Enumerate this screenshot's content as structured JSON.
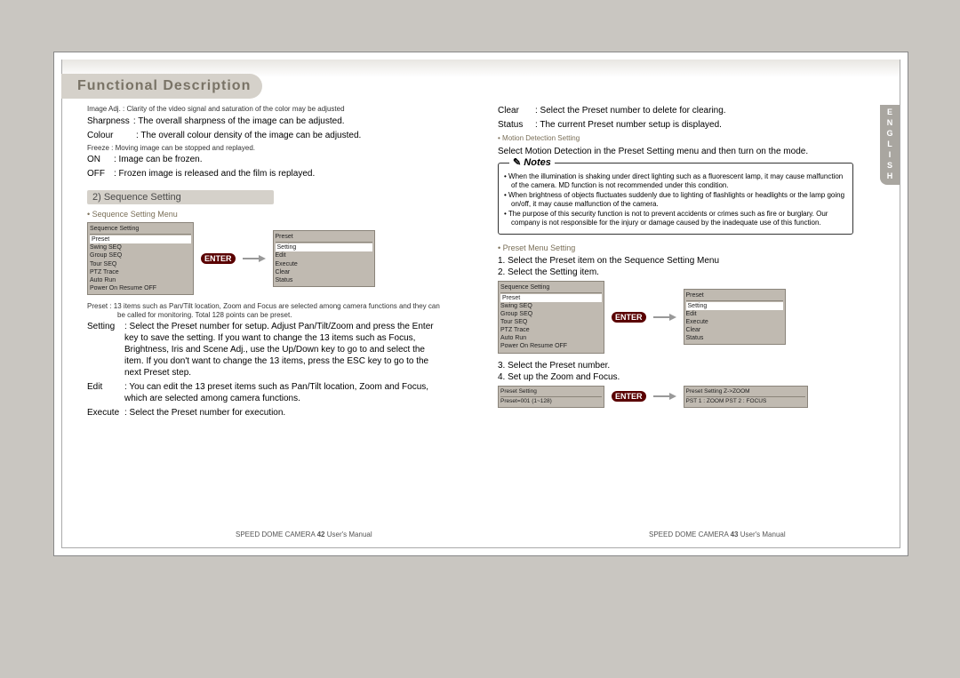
{
  "language_tab": "ENGLISH",
  "title": "Functional Description",
  "left": {
    "image_adj": {
      "label": "Image Adj.",
      "desc": ": Clarity of the video signal and saturation of the color may be adjusted"
    },
    "sharpness": {
      "label": "Sharpness",
      "desc": ": The overall sharpness of the image can be adjusted."
    },
    "colour": {
      "label": "Colour",
      "desc": ": The overall colour density of the image can be adjusted."
    },
    "freeze_desc": "Freeze : Moving image can be stopped and replayed.",
    "on": {
      "label": "ON",
      "desc": ": Image can be frozen."
    },
    "off": {
      "label": "OFF",
      "desc": ": Frozen image is released and the film is replayed."
    },
    "section_title": "2) Sequence Setting",
    "seq_menu_marker": "Sequence Setting Menu",
    "menu1_title": "Sequence Setting",
    "menu1_items": [
      "Preset",
      "Swing SEQ",
      "Group SEQ",
      "Tour SEQ",
      "PTZ Trace",
      "Auto Run",
      "Power On Resume OFF"
    ],
    "enter": "ENTER",
    "menu2_title": "Preset",
    "menu2_items": [
      "Setting",
      "Edit",
      "Execute",
      "Clear",
      "Status"
    ],
    "preset_desc": "Preset : 13 items such as Pan/Tilt location, Zoom and Focus are selected among camera functions and they can be called for monitoring. Total 128 points can be preset.",
    "setting": {
      "label": "Setting",
      "desc": ": Select the Preset number for setup. Adjust Pan/Tilt/Zoom and press the Enter key to save the setting. If you want to change the 13 items such as Focus, Brightness, Iris and Scene Adj., use the Up/Down key to go to and select the item. If you don't want to change the 13 items, press the ESC key to go to the next Preset step."
    },
    "edit": {
      "label": "Edit",
      "desc": ": You can edit the 13 preset items such as Pan/Tilt location, Zoom and Focus, which are selected among camera functions."
    },
    "execute": {
      "label": "Execute",
      "desc": ": Select the Preset number for execution."
    }
  },
  "right": {
    "clear": {
      "label": "Clear",
      "desc": ": Select the Preset number to delete for clearing."
    },
    "status": {
      "label": "Status",
      "desc": ": The current Preset number setup is displayed."
    },
    "motion_marker": "Motion Detection Setting",
    "motion_desc": "Select Motion Detection in the Preset Setting menu and then turn on the mode.",
    "notes_label": "Notes",
    "notes": [
      "• When the illumination is shaking under direct lighting such as a fluorescent lamp, it may cause malfunction of the camera. MD function is not recommended under this condition.",
      "• When brightness of objects fluctuates suddenly due to lighting of flashlights or headlights or the lamp going on/off, it may cause malfunction of the camera.",
      "• The purpose of this security function is not to prevent accidents or crimes such as fire or burglary. Our company is not responsible for the injury or damage caused by the inadequate use of this function."
    ],
    "preset_menu_marker": "Preset Menu Setting",
    "step1": "1. Select the Preset item on the Sequence Setting Menu",
    "step2": "2. Select the Setting item.",
    "menu3_title": "Sequence Setting",
    "menu3_items": [
      "Preset",
      "Swing SEQ",
      "Group SEQ",
      "Tour SEQ",
      "PTZ Trace",
      "Auto Run",
      "Power On Resume OFF"
    ],
    "menu4_title": "Preset",
    "menu4_items": [
      "Setting",
      "Edit",
      "Execute",
      "Clear",
      "Status"
    ],
    "step3": "3. Select the Preset number.",
    "step4": "4. Set up the Zoom and Focus.",
    "menu5_title": "Preset Setting",
    "menu5_body": "Preset=001 (1~128)",
    "menu6_title": "Preset Setting    Z->ZOOM",
    "menu6_body": "PST 1 : ZOOM  PST 2 : FOCUS"
  },
  "footer": {
    "brand": "SPEED DOME CAMERA",
    "pg_left": "42",
    "pg_right": "43",
    "man": "User's Manual"
  },
  "chart_data": {
    "type": "table",
    "title": "none",
    "categories": [],
    "values": []
  }
}
